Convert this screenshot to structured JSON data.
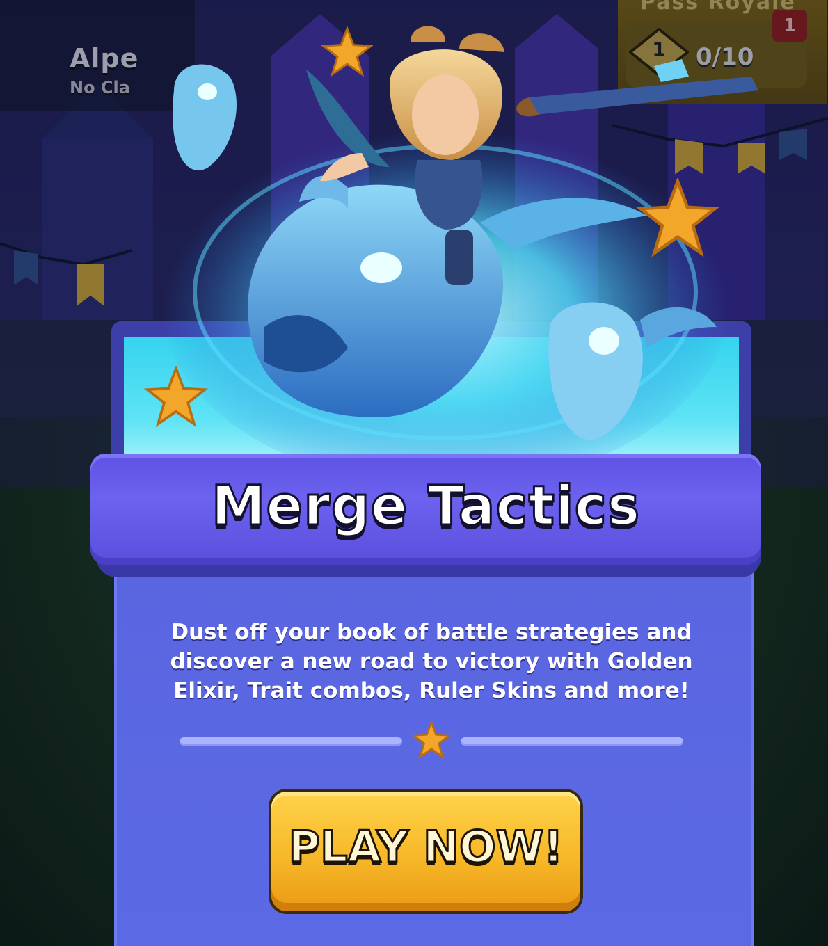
{
  "player": {
    "name": "Alpe",
    "clan": "No Cla"
  },
  "pass": {
    "title": "Pass Royale",
    "tier": "1",
    "progress": "0/10",
    "notification_count": "1"
  },
  "event": {
    "title": "Merge Tactics",
    "description_lines": [
      "Dust off your book of battle strategies and",
      "discover a new road to victory with Golden",
      "Elixir, Trait combos, Ruler Skins and more!"
    ],
    "cta_label": "PLAY NOW!"
  },
  "colors": {
    "banner": "#6c62ef",
    "card_body": "#5a66e0",
    "card_top_glow": "#36d3ee",
    "button": "#f7b829",
    "star": "#f2a62a"
  }
}
